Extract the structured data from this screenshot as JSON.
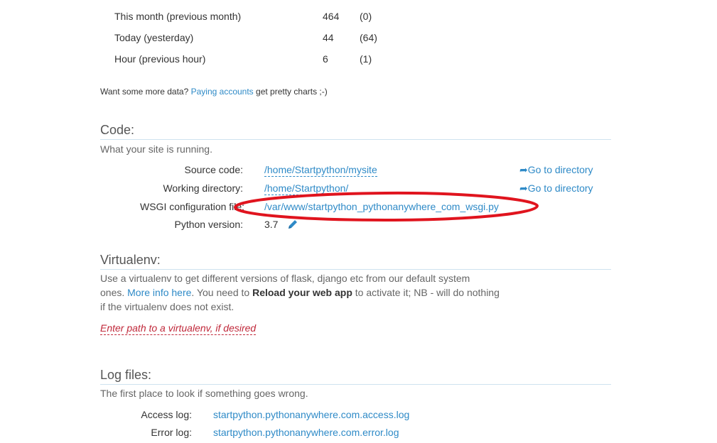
{
  "stats": {
    "rows": [
      {
        "label": "This month (previous month)",
        "value": "464",
        "prev": "(0)"
      },
      {
        "label": "Today (yesterday)",
        "value": "44",
        "prev": "(64)"
      },
      {
        "label": "Hour (previous hour)",
        "value": "6",
        "prev": "(1)"
      }
    ],
    "more_data_prefix": "Want some more data?",
    "more_data_link": "Paying accounts",
    "more_data_suffix": "get pretty charts ;-)"
  },
  "code": {
    "title": "Code:",
    "subtitle": "What your site is running.",
    "source_label": "Source code:",
    "source_value": "/home/Startpython/mysite",
    "workdir_label": "Working directory:",
    "workdir_value": "/home/Startpython/",
    "wsgi_label": "WSGI configuration file:",
    "wsgi_value": "/var/www/startpython_pythonanywhere_com_wsgi.py",
    "python_label": "Python version:",
    "python_value": "3.7",
    "goto_label": "Go to directory"
  },
  "virtualenv": {
    "title": "Virtualenv:",
    "line1": "Use a virtualenv to get different versions of flask, django etc from our default system",
    "line2_prefix": "ones.",
    "line2_link": "More info here",
    "line2_mid": ". You need to",
    "line2_bold": "Reload your web app",
    "line2_suffix": "to activate it; NB - will do nothing",
    "line3": "if the virtualenv does not exist.",
    "placeholder": "Enter path to a virtualenv, if desired"
  },
  "logs": {
    "title": "Log files:",
    "subtitle": "The first place to look if something goes wrong.",
    "access_label": "Access log:",
    "access_value": "startpython.pythonanywhere.com.access.log",
    "error_label": "Error log:",
    "error_value": "startpython.pythonanywhere.com.error.log"
  },
  "annotation": {
    "color": "#e0141e"
  },
  "colors": {
    "link": "#2e8ac7",
    "rule": "#cfe3ef",
    "placeholder": "#c0283a"
  }
}
